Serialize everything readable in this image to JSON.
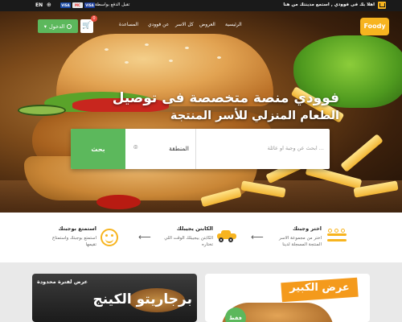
{
  "topbar": {
    "language": "EN",
    "payment_cards": [
      "VISA",
      "MC",
      "VISA"
    ],
    "payment_text": "تقبل الدفع بواسطة",
    "promo_text": "اهلا بك فى فوودي , استمع مدينتك من هنا"
  },
  "header": {
    "logo": "Foody",
    "nav": [
      "الرئيسية",
      "العروض",
      "كل الاسر",
      "عن فوودي",
      "المساعدة"
    ],
    "login_label": "الدخول",
    "cart_count": "0"
  },
  "hero": {
    "headline_line1": "فوودي منصة متخصصة فى توصيل",
    "headline_line2": "الطعام المنزلي للأسر المنتجة"
  },
  "search": {
    "query_placeholder": "ابحث عن وجبة او عائلة ...",
    "area_label": "المنطقة",
    "button_label": "بحث"
  },
  "features": [
    {
      "title": "اختر وجبتك",
      "desc": "اختر من مجموعة الاسر المنتجة المسجلة لدينا"
    },
    {
      "title": "الكابتن يجيبلك",
      "desc": "الكابتن بيجيبلك الوقت اللي تختاره"
    },
    {
      "title": "استمتع بوجبتك",
      "desc": "استمتع بوجبتك واستمتاع تقيمها"
    }
  ],
  "offers": [
    {
      "tag": "عرض لفترة محدودة",
      "title": "برجاريتو الكينج"
    },
    {
      "title": "عرض الكبير",
      "badge": "فقط"
    }
  ],
  "colors": {
    "accent": "#f7b41f",
    "green": "#5cb85c",
    "topbar": "#1a1a1a"
  }
}
